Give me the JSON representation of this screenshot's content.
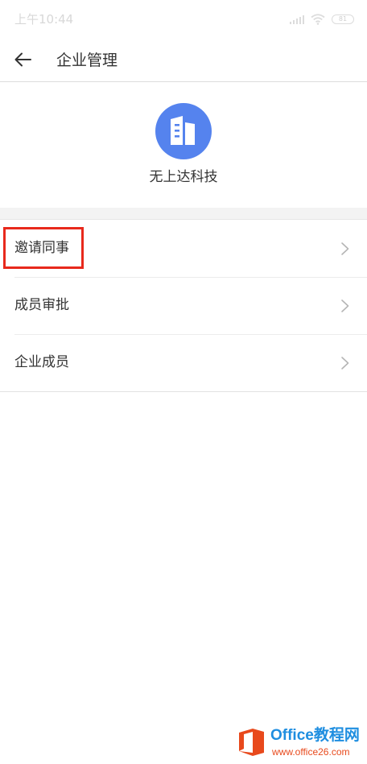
{
  "status_bar": {
    "time": "上午10:44",
    "battery": "81"
  },
  "header": {
    "title": "企业管理"
  },
  "company": {
    "name": "无上达科技",
    "logo_color": "#5583ee"
  },
  "menu": {
    "items": [
      {
        "label": "邀请同事",
        "highlighted": true
      },
      {
        "label": "成员审批",
        "highlighted": false
      },
      {
        "label": "企业成员",
        "highlighted": false
      }
    ]
  },
  "watermark": {
    "title": "Office教程网",
    "url": "www.office26.com"
  },
  "colors": {
    "accent": "#5583ee",
    "highlight": "#e8291c",
    "watermark_blue": "#1f8ee0",
    "watermark_orange": "#e8491c"
  }
}
